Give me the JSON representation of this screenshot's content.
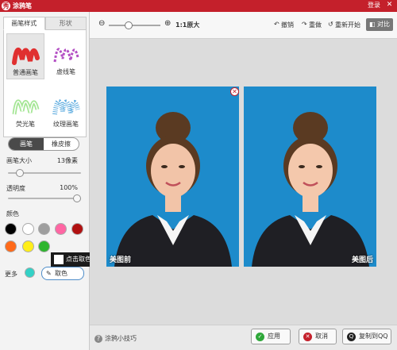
{
  "window": {
    "title": "涂鸦笔",
    "login": "登录"
  },
  "left": {
    "tabs": [
      "画笔样式",
      "形状"
    ],
    "brushes": [
      "普通画笔",
      "虚线笔",
      "荧光笔",
      "纹理画笔"
    ],
    "mode": {
      "brush": "画笔",
      "eraser": "橡皮擦"
    },
    "size": {
      "label": "画笔大小",
      "value": "13像素"
    },
    "opacity": {
      "label": "透明度",
      "value": "100%"
    },
    "color_label": "颜色",
    "swatches": [
      "#000000",
      "#ffffff",
      "#9e9e9e",
      "#ff66a3",
      "#b01010",
      "#ff6a1a",
      "#ffee1a",
      "#2fb52f",
      "#33d1c6"
    ],
    "more": "更多",
    "pick": "取色",
    "tooltip": "点击取色"
  },
  "toolbar": {
    "ratio": "1:1原大",
    "undo": "撤销",
    "redo": "重做",
    "restart": "重新开始",
    "compare": "对比"
  },
  "canvas": {
    "before": "美图前",
    "after": "美图后"
  },
  "bottom": {
    "tips": "涂鸦小技巧",
    "apply": "应用",
    "cancel": "取消",
    "share": "复制到QQ"
  }
}
